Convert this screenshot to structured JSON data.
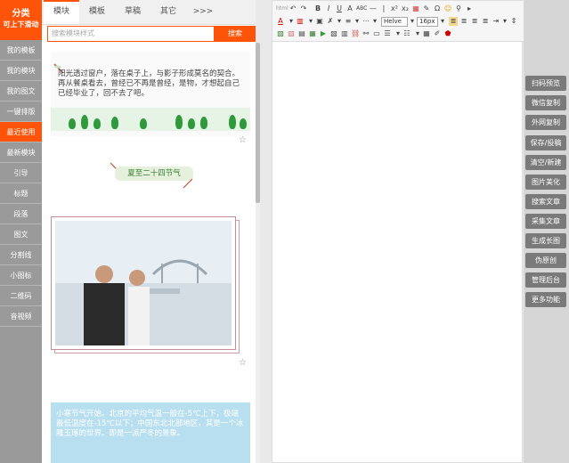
{
  "sidebar": {
    "title": "分类",
    "subtitle": "可上下滑动",
    "items": [
      "我的模板",
      "我的模块",
      "我的图文",
      "一键排版",
      "最近使用",
      "最新模块",
      "引导",
      "标题",
      "段落",
      "图文",
      "分割线",
      "小图标",
      "二维码",
      "音视频"
    ],
    "active": "最近使用"
  },
  "tabs": [
    "模块",
    "模板",
    "草稿",
    "其它",
    ">>>"
  ],
  "active_tab": "模块",
  "search": {
    "placeholder": "搜索模块样式",
    "button": "搜索"
  },
  "templates": {
    "t1_text": "阳光透过窗户，落在桌子上，与影子形成莫名的契合。再从餐桌看去，曾经已不再是曾经，是物，才想起自己已经毕业了，回不去了吧。",
    "t2_title": "夏至二十四节气",
    "t4_text": "小寒节气开始。北京的平均气温一般在-5℃上下，极端最低温度在-15℃以下；中国东北北部地区，其是一个冰雕玉琢的世界。即是一派严冬的景象。"
  },
  "toolbar": {
    "font_family": "Helve",
    "font_size": "16px"
  },
  "actions": [
    "扫码预览",
    "微信复制",
    "外网复制",
    "保存/投稿",
    "清空/新建",
    "图片美化",
    "搜索文章",
    "采集文章",
    "生成长图",
    "伪原创",
    "管理后台",
    "更多功能"
  ],
  "colors": {
    "accent": "#fe5409",
    "sidebar_bg": "#9a9a9a",
    "action_bg": "#7a7a7a"
  }
}
